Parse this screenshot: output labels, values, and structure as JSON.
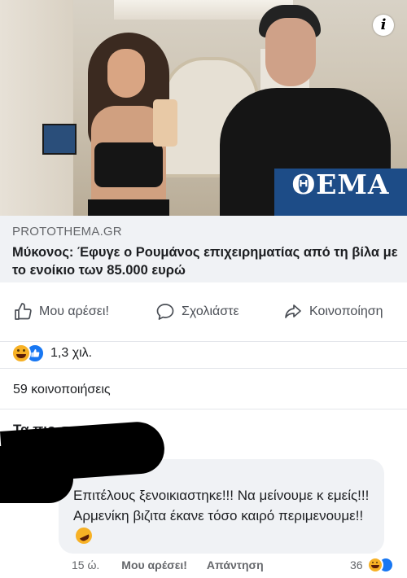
{
  "link": {
    "domain": "PROTOTHEMA.GR",
    "title": "Μύκονος: Έφυγε ο Ρουμάνος επιχειρηματίας από τη βίλα με το ενοίκιο των 85.000 ευρώ",
    "brand_label": "ΘΕΜΑ",
    "info_badge": "i"
  },
  "actions": {
    "like": "Μου αρέσει!",
    "comment": "Σχολιάστε",
    "share": "Κοινοποίηση"
  },
  "reactions": {
    "icons": [
      "haha-icon",
      "like-icon"
    ],
    "count": "1,3 χιλ."
  },
  "shares": "59 κοινοποιήσεις",
  "sort": {
    "label": "Τα πιο σχετικά"
  },
  "comment": {
    "text": "Επιτέλους ξενοικιαστηκε!!! Να μείνουμε κ εμείς!!!Αρμενίκη βιζιτα έκανε τόσο καιρό περιμενουμε!!",
    "emoji": "rofl-icon",
    "time": "15 ώ.",
    "like": "Μου αρέσει!",
    "reply": "Απάντηση",
    "reaction_count": "36"
  },
  "colors": {
    "brand_blue": "#1d4c87",
    "fb_blue": "#1877f2",
    "haha_yellow": "#f7b125",
    "bubble_gray": "#f0f2f5"
  }
}
